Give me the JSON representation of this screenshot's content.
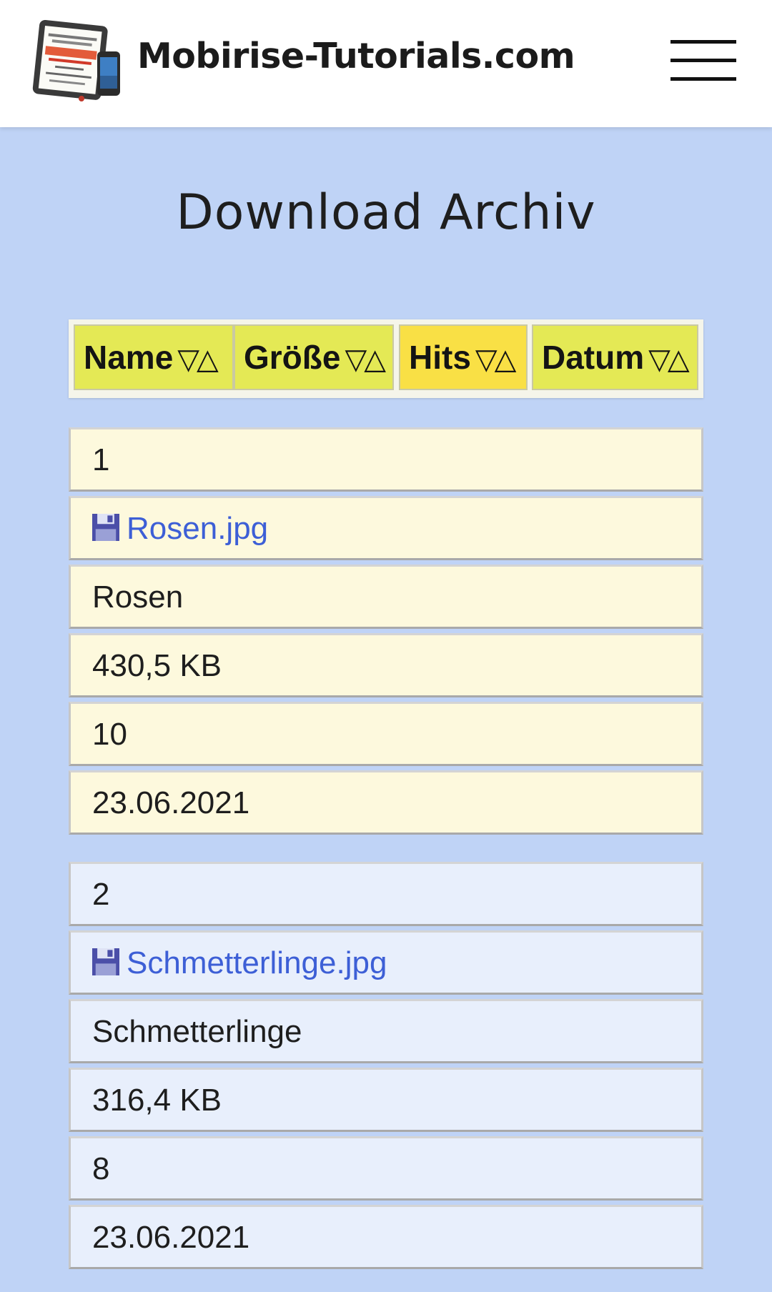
{
  "nav": {
    "brand": "Mobirise-Tutorials.com",
    "logo_alt": "Tutorials für MOBIRISE Website Builder von Thomas Peir-Herrmann"
  },
  "page": {
    "title": "Download Archiv"
  },
  "table": {
    "headers": [
      {
        "label": "Name",
        "sort": "▽△"
      },
      {
        "label": "Größe",
        "sort": "▽△"
      },
      {
        "label": "Hits",
        "sort": "▽△"
      },
      {
        "label": "Datum",
        "sort": "▽△"
      }
    ],
    "rows": [
      {
        "index": "1",
        "file": "Rosen.jpg",
        "name": "Rosen",
        "size": "430,5 KB",
        "hits": "10",
        "date": "23.06.2021"
      },
      {
        "index": "2",
        "file": "Schmetterlinge.jpg",
        "name": "Schmetterlinge",
        "size": "316,4 KB",
        "hits": "8",
        "date": "23.06.2021"
      }
    ]
  },
  "colors": {
    "page_background": "#bfd3f6",
    "header_cell": "#e4e955",
    "header_cell_active": "#f9e045",
    "row_odd": "#fdf9dd",
    "row_even": "#e8effc",
    "link": "#3d5fd6"
  },
  "icons": {
    "menu": "hamburger-menu-icon",
    "download": "floppy-disk-icon"
  }
}
